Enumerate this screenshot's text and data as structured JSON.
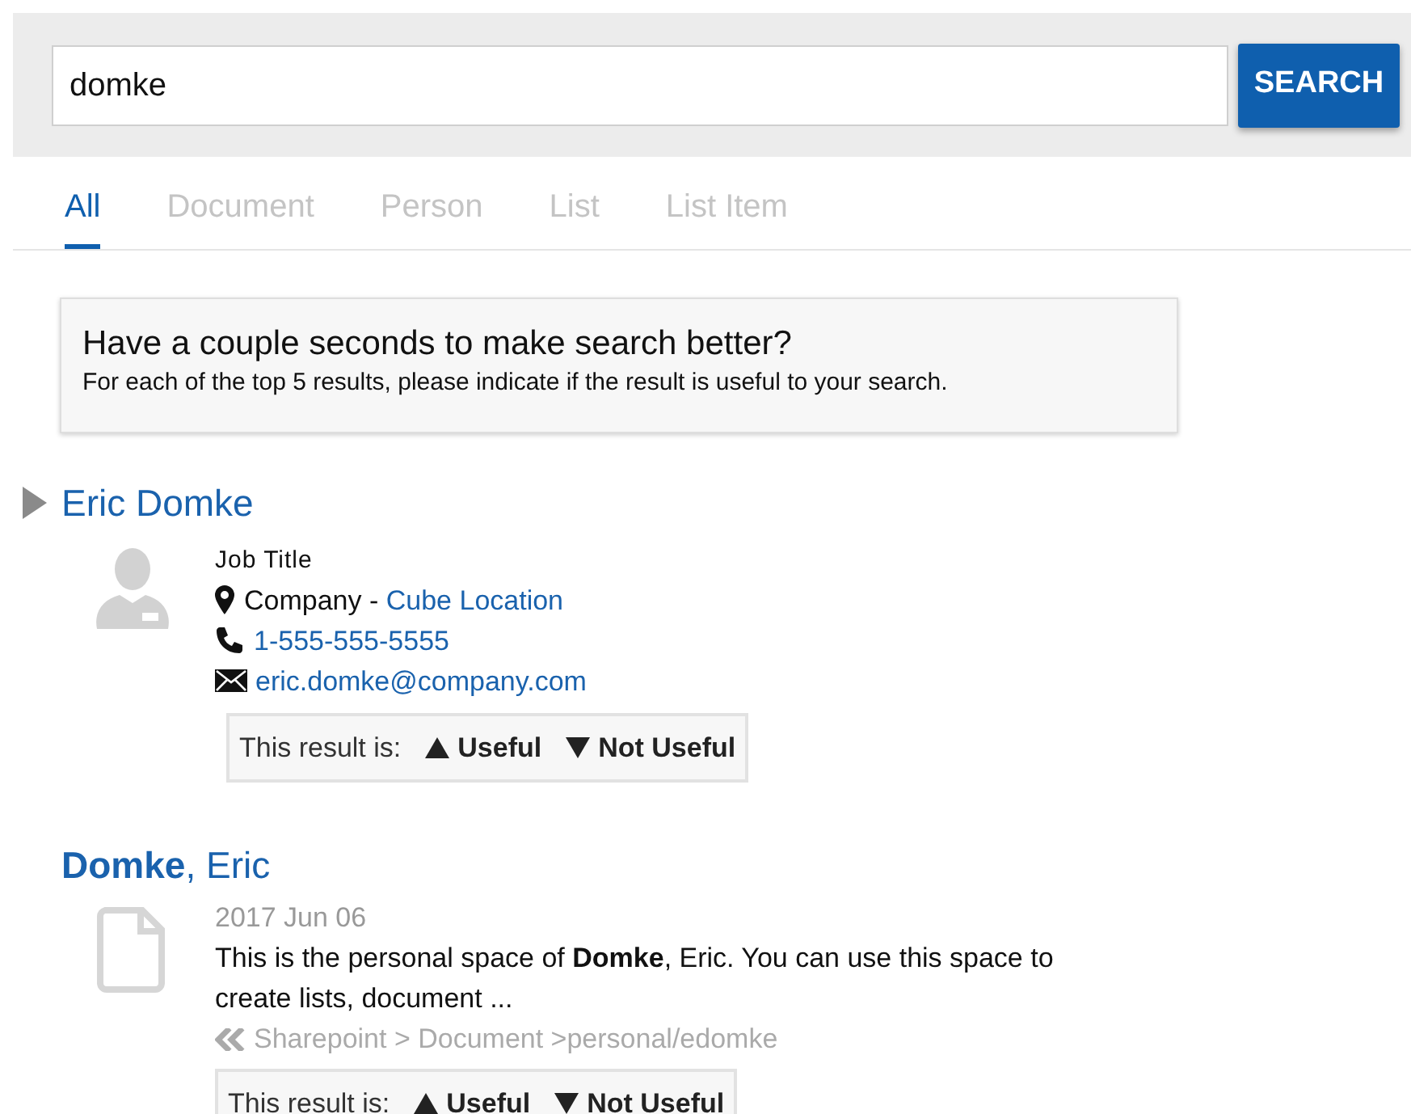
{
  "search": {
    "value": "domke",
    "button": "SEARCH"
  },
  "tabs": [
    {
      "label": "All",
      "selected": true
    },
    {
      "label": "Document",
      "selected": false
    },
    {
      "label": "Person",
      "selected": false
    },
    {
      "label": "List",
      "selected": false
    },
    {
      "label": "List Item",
      "selected": false
    }
  ],
  "survey": {
    "title": "Have a couple seconds to make search better?",
    "text": "For each of the top 5 results, please indicate if the result is useful to your search."
  },
  "results": [
    {
      "kind": "person",
      "title": "Eric Domke",
      "job_title": "Job Title",
      "company": "Company - ",
      "location": "Cube Location",
      "phone": "1-555-555-5555",
      "email": "eric.domke@company.com",
      "feedback": {
        "label": "This result is:",
        "useful": "Useful",
        "not_useful": "Not Useful"
      }
    },
    {
      "kind": "document",
      "title": "**Domke**, Eric",
      "date": "2017 Jun 06",
      "description": "This is the personal space of **Domke**, Eric. You can use this space to create lists, document ...",
      "path": "Sharepoint > Document >personal/edomke",
      "feedback": {
        "label": "This result is:",
        "useful": "Useful",
        "not_useful": "Not Useful"
      }
    }
  ]
}
